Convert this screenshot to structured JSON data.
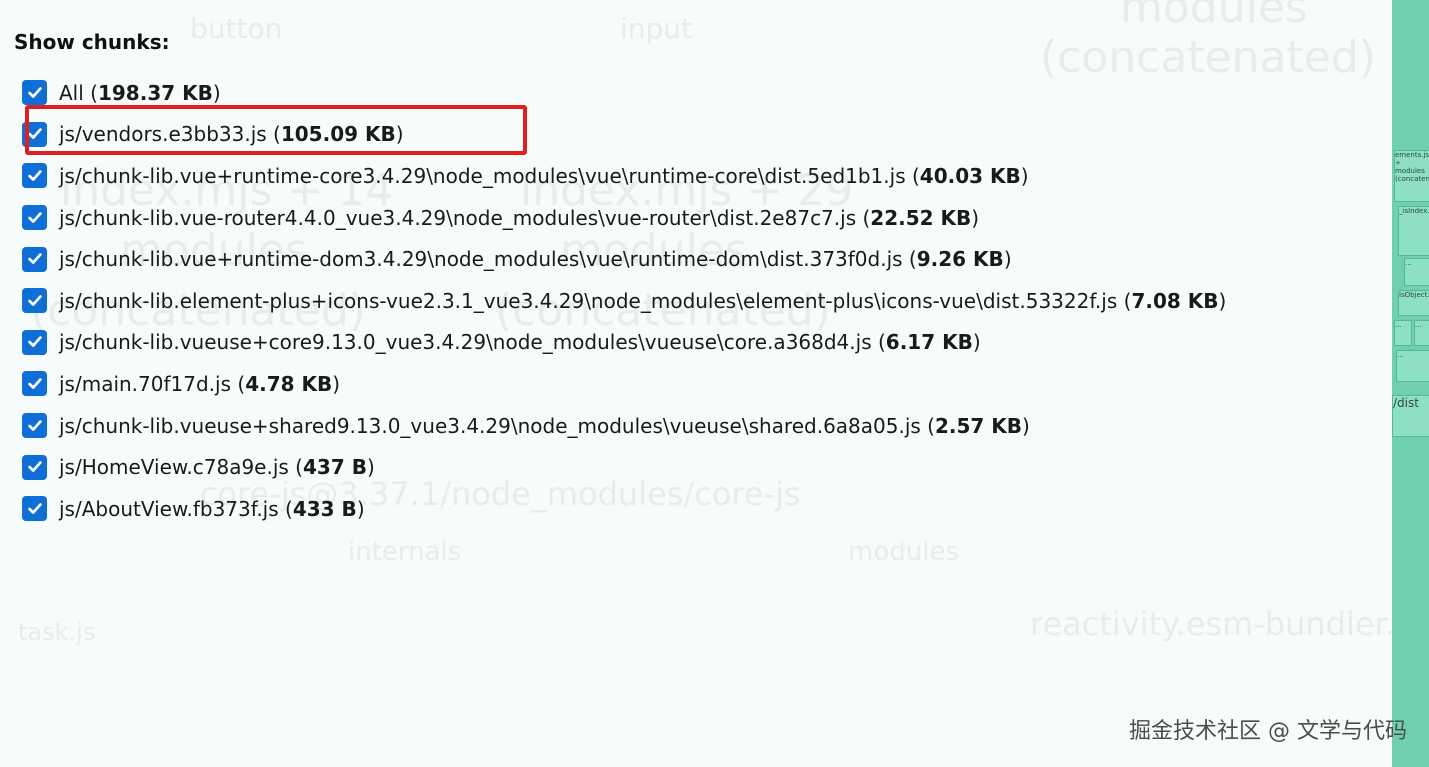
{
  "background": {
    "labels": [
      "button",
      "input",
      "modules",
      "(concatenated)",
      "index.mjs + 14",
      "index.mjs + 29",
      "modules",
      "modules",
      "(concatenated)",
      "(concatenated)",
      "core-js@3.37.1/node_modules/core-js",
      "internals",
      "modules",
      "task.js",
      "reactivity.esm-bundler.js"
    ],
    "treemap_cells": [
      "ements.js + modules (concatenated)",
      "_isIndex.js",
      "...",
      "isObject.js",
      "...",
      "...",
      "...",
      "/dist"
    ]
  },
  "sidebar": {
    "title": "Show chunks:",
    "chunks": [
      {
        "name": "All",
        "size": "198.37 KB",
        "checked": true
      },
      {
        "name": "js/vendors.e3bb33.js",
        "size": "105.09 KB",
        "checked": true,
        "highlighted": true
      },
      {
        "name": "js/chunk-lib.vue+runtime-core3.4.29\\node_modules\\vue\\runtime-core\\dist.5ed1b1.js",
        "size": "40.03 KB",
        "checked": true
      },
      {
        "name": "js/chunk-lib.vue-router4.4.0_vue3.4.29\\node_modules\\vue-router\\dist.2e87c7.js",
        "size": "22.52 KB",
        "checked": true
      },
      {
        "name": "js/chunk-lib.vue+runtime-dom3.4.29\\node_modules\\vue\\runtime-dom\\dist.373f0d.js",
        "size": "9.26 KB",
        "checked": true
      },
      {
        "name": "js/chunk-lib.element-plus+icons-vue2.3.1_vue3.4.29\\node_modules\\element-plus\\icons-vue\\dist.53322f.js",
        "size": "7.08 KB",
        "checked": true
      },
      {
        "name": "js/chunk-lib.vueuse+core9.13.0_vue3.4.29\\node_modules\\vueuse\\core.a368d4.js",
        "size": "6.17 KB",
        "checked": true
      },
      {
        "name": "js/main.70f17d.js",
        "size": "4.78 KB",
        "checked": true
      },
      {
        "name": "js/chunk-lib.vueuse+shared9.13.0_vue3.4.29\\node_modules\\vueuse\\shared.6a8a05.js",
        "size": "2.57 KB",
        "checked": true
      },
      {
        "name": "js/HomeView.c78a9e.js",
        "size": "437 B",
        "checked": true
      },
      {
        "name": "js/AboutView.fb373f.js",
        "size": "433 B",
        "checked": true
      }
    ]
  },
  "watermark": "掘金技术社区 @ 文学与代码",
  "colors": {
    "checkbox": "#0f6fd6",
    "highlight": "#e11d1d",
    "treemap_green": "#6fcfb0"
  }
}
